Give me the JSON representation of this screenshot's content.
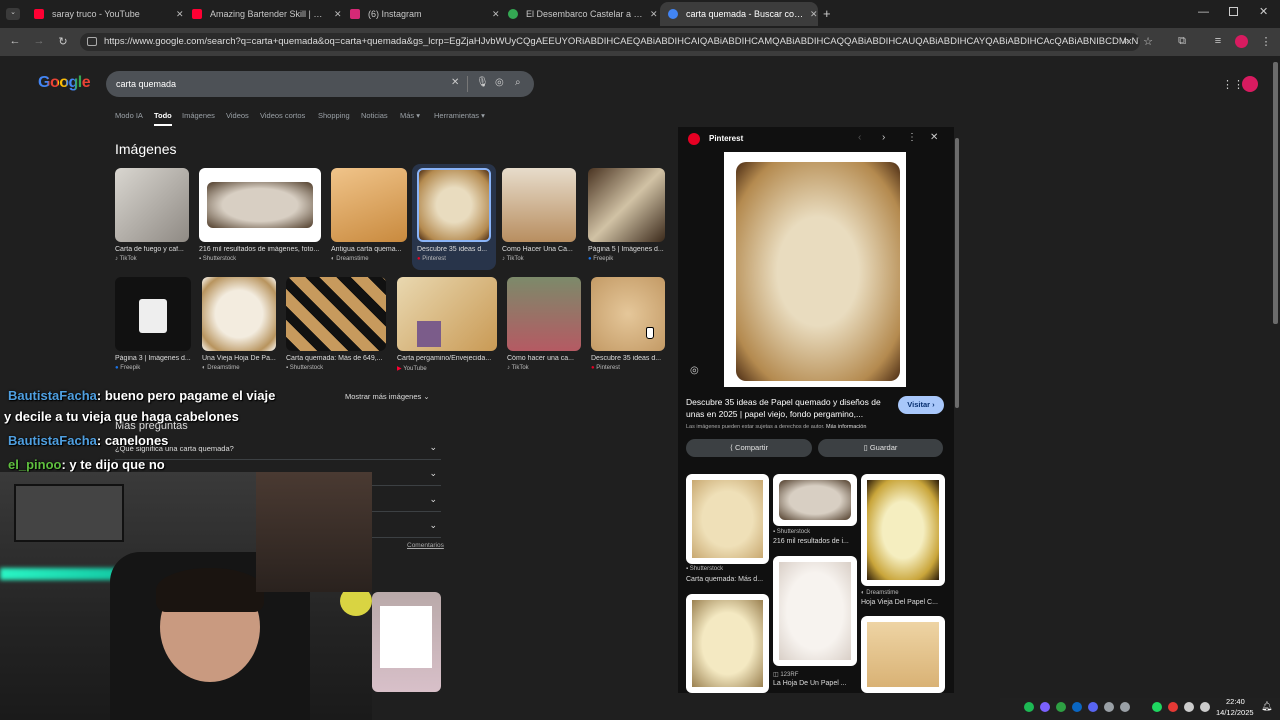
{
  "tabs": [
    {
      "title": "saray truco - YouTube",
      "color": "#ff0033"
    },
    {
      "title": "Amazing Bartender Skill | Cockt",
      "color": "#ff0033"
    },
    {
      "title": "(6) Instagram",
      "color": "#d62976"
    },
    {
      "title": "El Desembarco Castelar a José",
      "color": "#34a853"
    },
    {
      "title": "carta quemada - Buscar con Go",
      "color": "#4285f4"
    }
  ],
  "address": "https://www.google.com/search?q=carta+quemada&oq=carta+quemada&gs_lcrp=EgZjaHJvbWUyCQgAEEUYORiABDIHCAEQABiABDIHCAIQABiABDIHCAMQABiABDIHCAQQABiABDIHCAUQABiABDIHCAYQABiABDIHCAcQABiABNIBCDMxNTdq...",
  "logo": "Google",
  "search": {
    "value": "carta quemada"
  },
  "nav": [
    "Modo IA",
    "Todo",
    "Imágenes",
    "Videos",
    "Videos cortos",
    "Shopping",
    "Noticias",
    "Más",
    "Herramientas"
  ],
  "images_title": "Imágenes",
  "row1": [
    {
      "cap": "Carta de fuego y caf...",
      "src": "TikTok"
    },
    {
      "cap": "216 mil resultados de imágenes, foto...",
      "src": "Shutterstock"
    },
    {
      "cap": "Antigua carta quema...",
      "src": "Dreamstime"
    },
    {
      "cap": "Descubre 35 ideas d...",
      "src": "Pinterest"
    },
    {
      "cap": "Como Hacer Una Ca...",
      "src": "TikTok"
    },
    {
      "cap": "Página 5 | Imágenes d...",
      "src": "Freepik"
    }
  ],
  "row2": [
    {
      "cap": "Página 3 | Imágenes d...",
      "src": "Freepik"
    },
    {
      "cap": "Una Vieja Hoja De Pa...",
      "src": "Dreamstime"
    },
    {
      "cap": "Carta quemada: Más de 649,...",
      "src": "Shutterstock"
    },
    {
      "cap": "Carta pergamino/Envejecida...",
      "src": "YouTube"
    },
    {
      "cap": "Cómo hacer una ca...",
      "src": "TikTok"
    },
    {
      "cap": "Descubre 35 ideas d...",
      "src": "Pinterest"
    }
  ],
  "more_images": "Mostrar más imágenes",
  "people_ask": "Más preguntas",
  "question1": "¿Qué significa una carta quemada?",
  "comments": "Comentarios",
  "chat": [
    {
      "user": "BautistaFacha",
      "msg": ": bueno pero pagame el viaje"
    },
    {
      "user": "",
      "msg": "y decile a tu vieja que haga cabelones"
    },
    {
      "user": "BautistaFacha",
      "msg": ": canelones"
    },
    {
      "user": "el_pinoo",
      "msg": ": y te dijo que no"
    }
  ],
  "panel": {
    "source": "Pinterest",
    "title": "Descubre 35 ideas de Papel quemado y diseños de unas en 2025 | papel viejo, fondo pergamino,...",
    "visit": "Visitar",
    "rights": "Las imágenes pueden estar sujetas a derechos de autor.",
    "more_info": "Más información",
    "share": "Compartir",
    "save": "Guardar",
    "related": [
      {
        "src": "Shutterstock",
        "cap": "Carta quemada: Más d..."
      },
      {
        "src": "Shutterstock",
        "cap": "216 mil resultados de i..."
      },
      {
        "src": "Dreamstime",
        "cap": "Hoja Vieja Del Papel C..."
      },
      {
        "src": "123RF",
        "cap": "La Hoja De Un Papel ..."
      }
    ]
  },
  "clock": {
    "time": "22:40",
    "date": "14/12/2025"
  }
}
